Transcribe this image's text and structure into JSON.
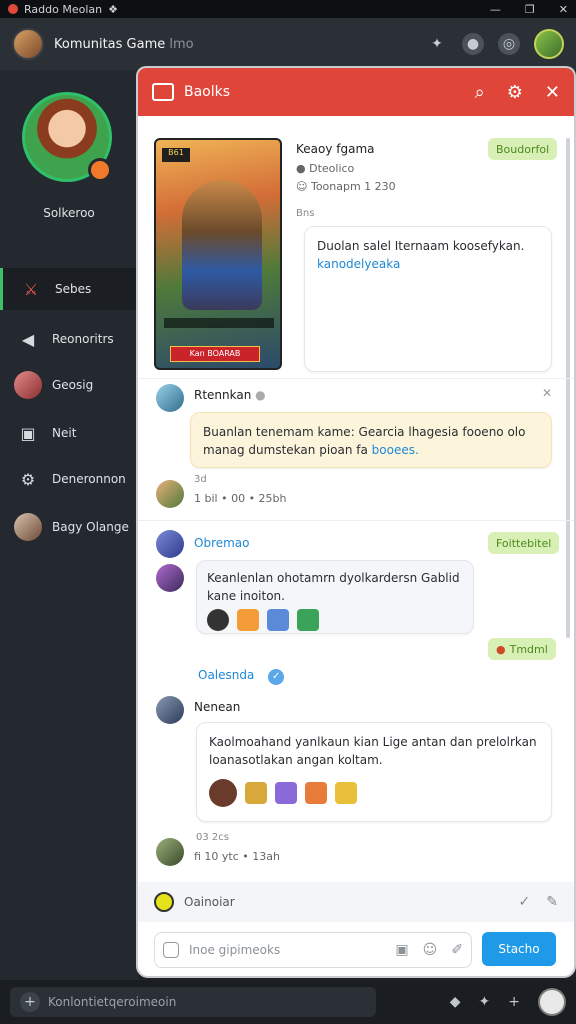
{
  "system_bar": {
    "title": "Raddo Meolan",
    "icon": "❖",
    "controls": [
      "—",
      "❐",
      "✕"
    ]
  },
  "header": {
    "title": "Komunitas Game",
    "subtitle": "lmo"
  },
  "sidebar": {
    "profile_name": "Solkeroo",
    "items": [
      {
        "label": "Sebes",
        "icon": "crossed-swords-icon"
      },
      {
        "label": "Reonoritrs",
        "icon": "megaphone-icon"
      },
      {
        "label": "Geosig",
        "icon": "avatar"
      },
      {
        "label": "Neit",
        "icon": "controller-icon"
      },
      {
        "label": "Deneronnon",
        "icon": "puzzle-icon"
      },
      {
        "label": "Bagy Olange",
        "icon": "avatar"
      }
    ]
  },
  "panel": {
    "title": "Baolks",
    "game": {
      "title": "Keaoy fgama",
      "line2": "Dteolico",
      "line3": "Toonapm 1 230",
      "meta": "Bns",
      "badge": "Boudorfol",
      "message_line1": "Duolan salel Iternaam koosefykan.",
      "message_line2": "kanodelyeaka",
      "card_tag": "B61",
      "card_cta": "Kan BOARAB"
    },
    "post1": {
      "name": "Rtennkan",
      "text_line1": "Buanlan tenemam kame: Gearcia lhagesia fooeno olo",
      "text_line2": "manag dumstekan pioan fa",
      "link": "booees.",
      "meta_line1": "3d",
      "meta_line2": "1 bil  • 00  • 25bh"
    },
    "thread": {
      "name": "Obremao",
      "badge1": "Foittebitel",
      "text_line1": "Keanlenlan ohotamrn dyolkardersn Gablid",
      "text_line2": "kane inoiton.",
      "badge2": "Tmdml",
      "divider": "Oalesnda"
    },
    "post2": {
      "name": "Nenean",
      "text_line1": "Kaolmoahand yanlkaun kian Lige antan dan prelolrkan",
      "text_line2": "loanasotlakan angan koltam.",
      "meta_line1": "03 2cs",
      "meta_line2": "fi 10 ytc  • 13ah"
    },
    "composer": {
      "top_label": "Oainoiar",
      "placeholder": "Inoe gipimeoks",
      "send": "Stacho"
    }
  },
  "bottom_bar": {
    "input_text": "Konlontietqeroimeoin"
  }
}
